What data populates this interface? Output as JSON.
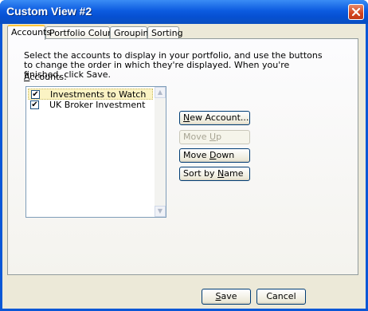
{
  "window": {
    "title": "Custom View #2"
  },
  "tabs": [
    {
      "label": "Accounts"
    },
    {
      "label": "Portfolio Columns"
    },
    {
      "label": "Grouping"
    },
    {
      "label": "Sorting"
    }
  ],
  "accounts_panel": {
    "description": "Select the accounts to display in your portfolio, and use the buttons to change the order in which they're displayed. When you're finished, click Save.",
    "list_label_underlined": "A",
    "list_label_rest": "ccounts:",
    "items": [
      {
        "label": "Investments to Watch",
        "checked": "✔"
      },
      {
        "label": "UK Broker Investment",
        "checked": "✔"
      }
    ],
    "buttons": {
      "new_account_u": "N",
      "new_account_rest": "ew Account...",
      "move_up_pre": "Move ",
      "move_up_u": "U",
      "move_up_rest": "p",
      "move_down_pre": "Move ",
      "move_down_u": "D",
      "move_down_rest": "own",
      "sort_pre": "Sort by ",
      "sort_u": "N",
      "sort_rest": "ame"
    }
  },
  "footer": {
    "save_u": "S",
    "save_rest": "ave",
    "cancel": "Cancel"
  }
}
